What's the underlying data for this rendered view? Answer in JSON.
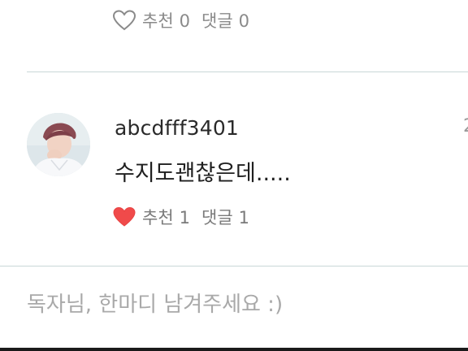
{
  "previous_comment": {
    "liked": false,
    "recommend_label": "추천",
    "recommend_count": "0",
    "reply_label": "댓글",
    "reply_count": "0"
  },
  "comment": {
    "username": "abcdfff3401",
    "text": "수지도괜찮은데.....",
    "date_partial": "2",
    "liked": true,
    "like_color": "#f04a4a",
    "recommend_label": "추천",
    "recommend_count": "1",
    "reply_label": "댓글",
    "reply_count": "1"
  },
  "reply_box": {
    "placeholder": "독자님, 한마디 남겨주세요 :)"
  },
  "colors": {
    "divider": "#c9d7d7",
    "muted_text": "#8a8a8a",
    "heart_liked": "#f04a4a"
  }
}
